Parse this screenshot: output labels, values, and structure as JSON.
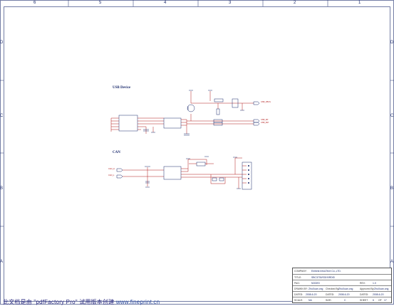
{
  "frame": {
    "columns": [
      "6",
      "5",
      "4",
      "3",
      "2",
      "1"
    ],
    "rows": [
      "D",
      "C",
      "B",
      "A"
    ]
  },
  "sections": {
    "usb_title": "USB Device",
    "can_title": "CAN"
  },
  "title_block": {
    "company_label": "COMPANY:",
    "company_value": "Embest Info&Tech Co.,LTD.",
    "title_label": "TITLE:",
    "title_value": "SBC3730/S30 BRDID",
    "page_label": "PAG:",
    "page_value": "NODE0",
    "drawn_label": "DRAWN BY:",
    "drawn_value": "ZhuXuan.ong",
    "checked_label": "Checked By:",
    "checked_value": "ZhuXuan.ong",
    "approved_label": "Approved By:",
    "approved_value": "ZhuXuan.ong",
    "rev_label": "REV:",
    "rev_value": "1.0",
    "dated1_label": "DATED:",
    "dated1_value": "2008-6-20",
    "dated2_label": "DATED:",
    "dated2_value": "2008-6-20",
    "dated3_label": "DATED:",
    "dated3_value": "2008-6-20",
    "scale_label": "SCALE:",
    "scale_value": "NA",
    "size_label": "SIZE:",
    "size_value": "C",
    "sheet_label": "SHEET",
    "sheet_value": "6",
    "of_label": "OF",
    "of_value": "17"
  },
  "watermark": {
    "text": "此文档是由 \"pdfFactory Pro\" 试用版本创建",
    "url": "www.fineprint.cn"
  },
  "net_labels": {
    "usb_dp": "USB_DP",
    "usb_dm": "USB_DM",
    "usb_vbus": "USB_VBUS",
    "can_h": "CAN_H",
    "can_l": "CAN_L"
  },
  "colors": {
    "frame": "#1a2a6c",
    "wire": "#b01818",
    "component": "#1a2a6c",
    "pin": "#b01818"
  }
}
